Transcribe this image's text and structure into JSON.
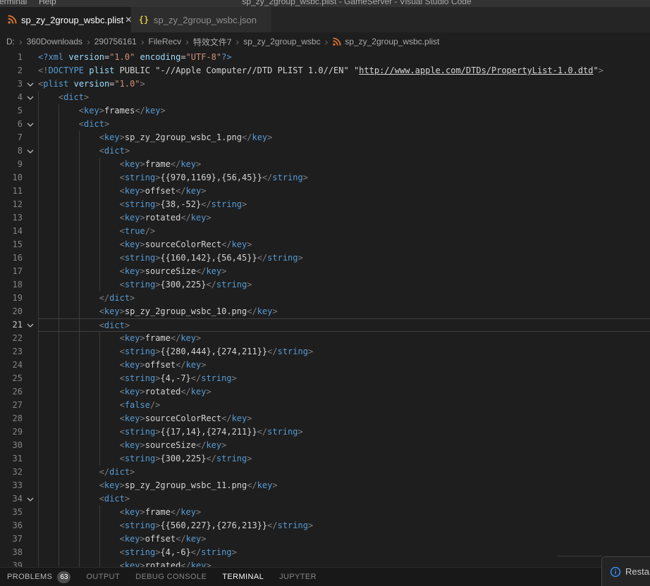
{
  "titlebar": {
    "title": "sp_zy_2group_wsbc.plist - GameServer - Visual Studio Code",
    "menu": [
      "Terminal",
      "Help"
    ]
  },
  "tabs": [
    {
      "label": "sp_zy_2group_wsbc.plist",
      "icon": "plist-rss-icon",
      "active": true,
      "close_glyph": "✕"
    },
    {
      "label": "sp_zy_2group_wsbc.json",
      "icon": "json-braces-icon",
      "icon_glyph": "{}",
      "active": false
    }
  ],
  "breadcrumb": {
    "items": [
      "D:",
      "360Downloads",
      "290756161",
      "FileRecv",
      "特效文件7",
      "sp_zy_2group_wsbc",
      "sp_zy_2group_wsbc.plist"
    ],
    "separator": "›"
  },
  "editor": {
    "token_colors": {
      "p": "#808080",
      "t": "#569cd6",
      "a": "#9cdcfe",
      "s": "#ce9178",
      "w": "#d4d4d4",
      "u": "#d4d4d4"
    },
    "lines": [
      {
        "n": 1,
        "ind": 0,
        "tok": [
          [
            "t",
            "<?xml"
          ],
          [
            "w",
            " "
          ],
          [
            "a",
            "version"
          ],
          [
            "w",
            "="
          ],
          [
            "s",
            "\"1.0\""
          ],
          [
            "w",
            " "
          ],
          [
            "a",
            "encoding"
          ],
          [
            "w",
            "="
          ],
          [
            "s",
            "\"UTF-8\""
          ],
          [
            "t",
            "?>"
          ]
        ]
      },
      {
        "n": 2,
        "ind": 0,
        "tok": [
          [
            "p",
            "<!"
          ],
          [
            "t",
            "DOCTYPE"
          ],
          [
            "w",
            " "
          ],
          [
            "a",
            "plist"
          ],
          [
            "w",
            " PUBLIC \"-//Apple Computer//DTD PLIST 1.0//EN\" \""
          ],
          [
            "u",
            "http://www.apple.com/DTDs/PropertyList-1.0.dtd"
          ],
          [
            "w",
            "\""
          ],
          [
            "p",
            ">"
          ]
        ]
      },
      {
        "n": 3,
        "ind": 0,
        "fold": true,
        "tok": [
          [
            "p",
            "<"
          ],
          [
            "t",
            "plist"
          ],
          [
            "w",
            " "
          ],
          [
            "a",
            "version"
          ],
          [
            "w",
            "="
          ],
          [
            "s",
            "\"1.0\""
          ],
          [
            "p",
            ">"
          ]
        ]
      },
      {
        "n": 4,
        "ind": 1,
        "fold": true,
        "tok": [
          [
            "p",
            "<"
          ],
          [
            "t",
            "dict"
          ],
          [
            "p",
            ">"
          ]
        ]
      },
      {
        "n": 5,
        "ind": 2,
        "tok": [
          [
            "p",
            "<"
          ],
          [
            "t",
            "key"
          ],
          [
            "p",
            ">"
          ],
          [
            "w",
            "frames"
          ],
          [
            "p",
            "</"
          ],
          [
            "t",
            "key"
          ],
          [
            "p",
            ">"
          ]
        ]
      },
      {
        "n": 6,
        "ind": 2,
        "fold": true,
        "tok": [
          [
            "p",
            "<"
          ],
          [
            "t",
            "dict"
          ],
          [
            "p",
            ">"
          ]
        ]
      },
      {
        "n": 7,
        "ind": 3,
        "tok": [
          [
            "p",
            "<"
          ],
          [
            "t",
            "key"
          ],
          [
            "p",
            ">"
          ],
          [
            "w",
            "sp_zy_2group_wsbc_1.png"
          ],
          [
            "p",
            "</"
          ],
          [
            "t",
            "key"
          ],
          [
            "p",
            ">"
          ]
        ]
      },
      {
        "n": 8,
        "ind": 3,
        "fold": true,
        "tok": [
          [
            "p",
            "<"
          ],
          [
            "t",
            "dict"
          ],
          [
            "p",
            ">"
          ]
        ]
      },
      {
        "n": 9,
        "ind": 4,
        "tok": [
          [
            "p",
            "<"
          ],
          [
            "t",
            "key"
          ],
          [
            "p",
            ">"
          ],
          [
            "w",
            "frame"
          ],
          [
            "p",
            "</"
          ],
          [
            "t",
            "key"
          ],
          [
            "p",
            ">"
          ]
        ]
      },
      {
        "n": 10,
        "ind": 4,
        "tok": [
          [
            "p",
            "<"
          ],
          [
            "t",
            "string"
          ],
          [
            "p",
            ">"
          ],
          [
            "w",
            "{{970,1169},{56,45}}"
          ],
          [
            "p",
            "</"
          ],
          [
            "t",
            "string"
          ],
          [
            "p",
            ">"
          ]
        ]
      },
      {
        "n": 11,
        "ind": 4,
        "tok": [
          [
            "p",
            "<"
          ],
          [
            "t",
            "key"
          ],
          [
            "p",
            ">"
          ],
          [
            "w",
            "offset"
          ],
          [
            "p",
            "</"
          ],
          [
            "t",
            "key"
          ],
          [
            "p",
            ">"
          ]
        ]
      },
      {
        "n": 12,
        "ind": 4,
        "tok": [
          [
            "p",
            "<"
          ],
          [
            "t",
            "string"
          ],
          [
            "p",
            ">"
          ],
          [
            "w",
            "{38,-52}"
          ],
          [
            "p",
            "</"
          ],
          [
            "t",
            "string"
          ],
          [
            "p",
            ">"
          ]
        ]
      },
      {
        "n": 13,
        "ind": 4,
        "tok": [
          [
            "p",
            "<"
          ],
          [
            "t",
            "key"
          ],
          [
            "p",
            ">"
          ],
          [
            "w",
            "rotated"
          ],
          [
            "p",
            "</"
          ],
          [
            "t",
            "key"
          ],
          [
            "p",
            ">"
          ]
        ]
      },
      {
        "n": 14,
        "ind": 4,
        "tok": [
          [
            "p",
            "<"
          ],
          [
            "t",
            "true"
          ],
          [
            "p",
            "/>"
          ]
        ]
      },
      {
        "n": 15,
        "ind": 4,
        "tok": [
          [
            "p",
            "<"
          ],
          [
            "t",
            "key"
          ],
          [
            "p",
            ">"
          ],
          [
            "w",
            "sourceColorRect"
          ],
          [
            "p",
            "</"
          ],
          [
            "t",
            "key"
          ],
          [
            "p",
            ">"
          ]
        ]
      },
      {
        "n": 16,
        "ind": 4,
        "tok": [
          [
            "p",
            "<"
          ],
          [
            "t",
            "string"
          ],
          [
            "p",
            ">"
          ],
          [
            "w",
            "{{160,142},{56,45}}"
          ],
          [
            "p",
            "</"
          ],
          [
            "t",
            "string"
          ],
          [
            "p",
            ">"
          ]
        ]
      },
      {
        "n": 17,
        "ind": 4,
        "tok": [
          [
            "p",
            "<"
          ],
          [
            "t",
            "key"
          ],
          [
            "p",
            ">"
          ],
          [
            "w",
            "sourceSize"
          ],
          [
            "p",
            "</"
          ],
          [
            "t",
            "key"
          ],
          [
            "p",
            ">"
          ]
        ]
      },
      {
        "n": 18,
        "ind": 4,
        "tok": [
          [
            "p",
            "<"
          ],
          [
            "t",
            "string"
          ],
          [
            "p",
            ">"
          ],
          [
            "w",
            "{300,225}"
          ],
          [
            "p",
            "</"
          ],
          [
            "t",
            "string"
          ],
          [
            "p",
            ">"
          ]
        ]
      },
      {
        "n": 19,
        "ind": 3,
        "tok": [
          [
            "p",
            "</"
          ],
          [
            "t",
            "dict"
          ],
          [
            "p",
            ">"
          ]
        ]
      },
      {
        "n": 20,
        "ind": 3,
        "tok": [
          [
            "p",
            "<"
          ],
          [
            "t",
            "key"
          ],
          [
            "p",
            ">"
          ],
          [
            "w",
            "sp_zy_2group_wsbc_10.png"
          ],
          [
            "p",
            "</"
          ],
          [
            "t",
            "key"
          ],
          [
            "p",
            ">"
          ]
        ]
      },
      {
        "n": 21,
        "ind": 3,
        "fold": true,
        "cur": true,
        "tok": [
          [
            "p",
            "<"
          ],
          [
            "t",
            "dict"
          ],
          [
            "p",
            ">"
          ]
        ]
      },
      {
        "n": 22,
        "ind": 4,
        "tok": [
          [
            "p",
            "<"
          ],
          [
            "t",
            "key"
          ],
          [
            "p",
            ">"
          ],
          [
            "w",
            "frame"
          ],
          [
            "p",
            "</"
          ],
          [
            "t",
            "key"
          ],
          [
            "p",
            ">"
          ]
        ]
      },
      {
        "n": 23,
        "ind": 4,
        "tok": [
          [
            "p",
            "<"
          ],
          [
            "t",
            "string"
          ],
          [
            "p",
            ">"
          ],
          [
            "w",
            "{{280,444},{274,211}}"
          ],
          [
            "p",
            "</"
          ],
          [
            "t",
            "string"
          ],
          [
            "p",
            ">"
          ]
        ]
      },
      {
        "n": 24,
        "ind": 4,
        "tok": [
          [
            "p",
            "<"
          ],
          [
            "t",
            "key"
          ],
          [
            "p",
            ">"
          ],
          [
            "w",
            "offset"
          ],
          [
            "p",
            "</"
          ],
          [
            "t",
            "key"
          ],
          [
            "p",
            ">"
          ]
        ]
      },
      {
        "n": 25,
        "ind": 4,
        "tok": [
          [
            "p",
            "<"
          ],
          [
            "t",
            "string"
          ],
          [
            "p",
            ">"
          ],
          [
            "w",
            "{4,-7}"
          ],
          [
            "p",
            "</"
          ],
          [
            "t",
            "string"
          ],
          [
            "p",
            ">"
          ]
        ]
      },
      {
        "n": 26,
        "ind": 4,
        "tok": [
          [
            "p",
            "<"
          ],
          [
            "t",
            "key"
          ],
          [
            "p",
            ">"
          ],
          [
            "w",
            "rotated"
          ],
          [
            "p",
            "</"
          ],
          [
            "t",
            "key"
          ],
          [
            "p",
            ">"
          ]
        ]
      },
      {
        "n": 27,
        "ind": 4,
        "tok": [
          [
            "p",
            "<"
          ],
          [
            "t",
            "false"
          ],
          [
            "p",
            "/>"
          ]
        ]
      },
      {
        "n": 28,
        "ind": 4,
        "tok": [
          [
            "p",
            "<"
          ],
          [
            "t",
            "key"
          ],
          [
            "p",
            ">"
          ],
          [
            "w",
            "sourceColorRect"
          ],
          [
            "p",
            "</"
          ],
          [
            "t",
            "key"
          ],
          [
            "p",
            ">"
          ]
        ]
      },
      {
        "n": 29,
        "ind": 4,
        "tok": [
          [
            "p",
            "<"
          ],
          [
            "t",
            "string"
          ],
          [
            "p",
            ">"
          ],
          [
            "w",
            "{{17,14},{274,211}}"
          ],
          [
            "p",
            "</"
          ],
          [
            "t",
            "string"
          ],
          [
            "p",
            ">"
          ]
        ]
      },
      {
        "n": 30,
        "ind": 4,
        "tok": [
          [
            "p",
            "<"
          ],
          [
            "t",
            "key"
          ],
          [
            "p",
            ">"
          ],
          [
            "w",
            "sourceSize"
          ],
          [
            "p",
            "</"
          ],
          [
            "t",
            "key"
          ],
          [
            "p",
            ">"
          ]
        ]
      },
      {
        "n": 31,
        "ind": 4,
        "tok": [
          [
            "p",
            "<"
          ],
          [
            "t",
            "string"
          ],
          [
            "p",
            ">"
          ],
          [
            "w",
            "{300,225}"
          ],
          [
            "p",
            "</"
          ],
          [
            "t",
            "string"
          ],
          [
            "p",
            ">"
          ]
        ]
      },
      {
        "n": 32,
        "ind": 3,
        "tok": [
          [
            "p",
            "</"
          ],
          [
            "t",
            "dict"
          ],
          [
            "p",
            ">"
          ]
        ]
      },
      {
        "n": 33,
        "ind": 3,
        "tok": [
          [
            "p",
            "<"
          ],
          [
            "t",
            "key"
          ],
          [
            "p",
            ">"
          ],
          [
            "w",
            "sp_zy_2group_wsbc_11.png"
          ],
          [
            "p",
            "</"
          ],
          [
            "t",
            "key"
          ],
          [
            "p",
            ">"
          ]
        ]
      },
      {
        "n": 34,
        "ind": 3,
        "fold": true,
        "tok": [
          [
            "p",
            "<"
          ],
          [
            "t",
            "dict"
          ],
          [
            "p",
            ">"
          ]
        ]
      },
      {
        "n": 35,
        "ind": 4,
        "tok": [
          [
            "p",
            "<"
          ],
          [
            "t",
            "key"
          ],
          [
            "p",
            ">"
          ],
          [
            "w",
            "frame"
          ],
          [
            "p",
            "</"
          ],
          [
            "t",
            "key"
          ],
          [
            "p",
            ">"
          ]
        ]
      },
      {
        "n": 36,
        "ind": 4,
        "tok": [
          [
            "p",
            "<"
          ],
          [
            "t",
            "string"
          ],
          [
            "p",
            ">"
          ],
          [
            "w",
            "{{560,227},{276,213}}"
          ],
          [
            "p",
            "</"
          ],
          [
            "t",
            "string"
          ],
          [
            "p",
            ">"
          ]
        ]
      },
      {
        "n": 37,
        "ind": 4,
        "tok": [
          [
            "p",
            "<"
          ],
          [
            "t",
            "key"
          ],
          [
            "p",
            ">"
          ],
          [
            "w",
            "offset"
          ],
          [
            "p",
            "</"
          ],
          [
            "t",
            "key"
          ],
          [
            "p",
            ">"
          ]
        ]
      },
      {
        "n": 38,
        "ind": 4,
        "tok": [
          [
            "p",
            "<"
          ],
          [
            "t",
            "string"
          ],
          [
            "p",
            ">"
          ],
          [
            "w",
            "{4,-6}"
          ],
          [
            "p",
            "</"
          ],
          [
            "t",
            "string"
          ],
          [
            "p",
            ">"
          ]
        ]
      },
      {
        "n": 39,
        "ind": 4,
        "tok": [
          [
            "p",
            "<"
          ],
          [
            "t",
            "key"
          ],
          [
            "p",
            ">"
          ],
          [
            "w",
            "rotated"
          ],
          [
            "p",
            "</"
          ],
          [
            "t",
            "key"
          ],
          [
            "p",
            ">"
          ]
        ]
      }
    ]
  },
  "panel": {
    "tabs": [
      {
        "label": "PROBLEMS",
        "badge": "63"
      },
      {
        "label": "OUTPUT"
      },
      {
        "label": "DEBUG CONSOLE"
      },
      {
        "label": "TERMINAL"
      },
      {
        "label": "JUPYTER"
      }
    ]
  },
  "notification": {
    "label": "Restart"
  },
  "colors": {
    "accent_blue": "#569cd6",
    "plist_icon_orange": "#e37933",
    "json_icon_yellow": "#cbcb41",
    "info_blue": "#3794ff"
  }
}
